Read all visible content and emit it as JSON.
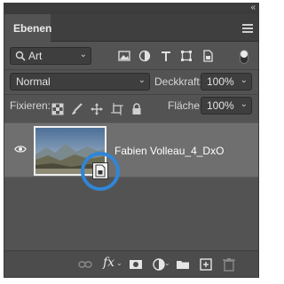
{
  "panel": {
    "tab_label": "Ebenen",
    "collapse_glyph": "«",
    "menu_icon": "hamburger-menu-icon"
  },
  "filter": {
    "type_label": "Art",
    "icons": [
      "image-filter-icon",
      "adjustment-filter-icon",
      "type-filter-icon",
      "shape-filter-icon",
      "smart-object-filter-icon"
    ],
    "toggle": "filter-toggle"
  },
  "blend": {
    "mode": "Normal",
    "opacity_label": "Deckkraft:",
    "opacity_value": "100%"
  },
  "lock": {
    "label": "Fixieren:",
    "icons": [
      "lock-transparent-icon",
      "lock-paint-icon",
      "lock-position-icon",
      "lock-artboard-icon",
      "lock-all-icon"
    ],
    "fill_label": "Fläche:",
    "fill_value": "100%"
  },
  "layers": [
    {
      "name": "Fabien Volleau_4_DxO",
      "visible": true,
      "smart_object": true
    }
  ],
  "bottom_icons": [
    "link-layers-icon",
    "fx-icon",
    "mask-icon",
    "adjustment-layer-icon",
    "folder-icon",
    "new-layer-icon",
    "trash-icon"
  ],
  "colors": {
    "panel_bg": "#535353",
    "selected_layer": "#6f6f6f",
    "highlight_ring": "#2f86d8"
  }
}
